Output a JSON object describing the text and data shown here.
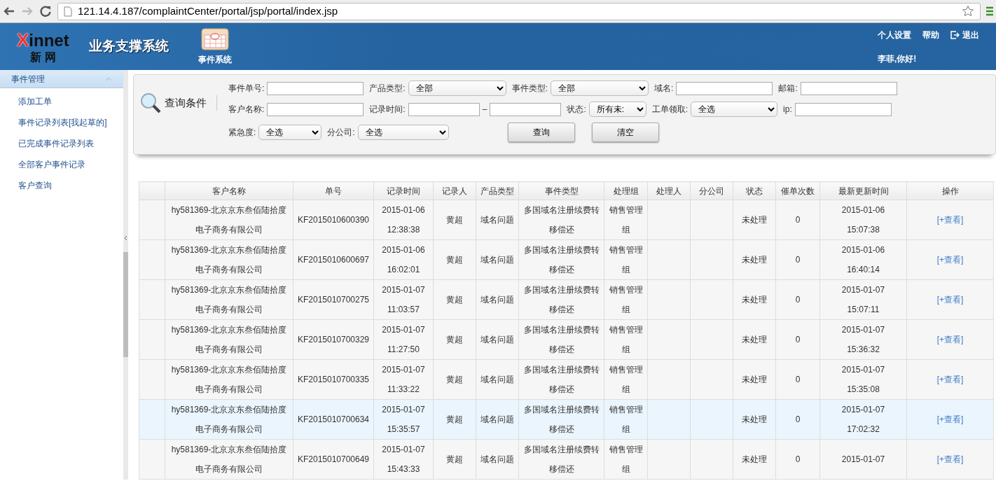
{
  "browser": {
    "url": "121.14.4.187/complaintCenter/portal/jsp/portal/index.jsp",
    "forward_disabled": true
  },
  "header": {
    "logo": {
      "mark": "X",
      "word": "innet",
      "cn": "新 网"
    },
    "title": "业务支撑系统",
    "app": "事件系统",
    "links": [
      {
        "label": "个人设置",
        "kind": "text"
      },
      {
        "label": "帮助",
        "kind": "text"
      },
      {
        "label": "退出",
        "kind": "exit"
      }
    ],
    "greeting": "李菲,你好!"
  },
  "sidebar": {
    "title": "事件管理",
    "expanded": true,
    "items": [
      "添加工单",
      "事件记录列表[我起草的]",
      "已完成事件记录列表",
      "全部客户事件记录",
      "客户查询"
    ]
  },
  "query": {
    "title": "查询条件",
    "rows": [
      [
        {
          "label": "事件单号:",
          "kind": "text"
        },
        {
          "label": "产品类型:",
          "kind": "select",
          "value": "全部"
        },
        {
          "label": "事件类型:",
          "kind": "select",
          "value": "全部"
        },
        {
          "label": "域名:",
          "kind": "text"
        },
        {
          "label": "邮箱:",
          "kind": "text"
        }
      ],
      [
        {
          "label": "客户名称:",
          "kind": "text"
        },
        {
          "label": "记录时间:",
          "kind": "range",
          "separator": "–"
        },
        {
          "label": "状态:",
          "kind": "select",
          "value": "所有未:"
        },
        {
          "label": "工单领取:",
          "kind": "select",
          "value": "全选"
        },
        {
          "label": "ip:",
          "kind": "text"
        }
      ],
      [
        {
          "label": "紧急度:",
          "kind": "select",
          "value": "全选"
        },
        {
          "label": "分公司:",
          "kind": "select",
          "value": "全选"
        }
      ]
    ],
    "buttons": [
      "查询",
      "清空"
    ]
  },
  "table": {
    "columns": [
      "",
      "客户名称",
      "单号",
      "记录时间",
      "记录人",
      "产品类型",
      "事件类型",
      "处理组",
      "处理人",
      "分公司",
      "状态",
      "催单次数",
      "最新更新时间",
      "操作"
    ],
    "rows": [
      {
        "highlighted": false,
        "cells": [
          "",
          "hy581369-北京京东叁佰陆拾度电子商务有限公司",
          "KF2015010600390",
          "2015-01-06 12:38:38",
          "黄超",
          "域名问题",
          "多国域名注册续费转移偿还",
          "销售管理组",
          "",
          "",
          "未处理",
          "0",
          "2015-01-06 15:07:38",
          "[+查看]"
        ]
      },
      {
        "highlighted": false,
        "cells": [
          "",
          "hy581369-北京京东叁佰陆拾度电子商务有限公司",
          "KF2015010600697",
          "2015-01-06 16:02:01",
          "黄超",
          "域名问题",
          "多国域名注册续费转移偿还",
          "销售管理组",
          "",
          "",
          "未处理",
          "0",
          "2015-01-06 16:40:14",
          "[+查看]"
        ]
      },
      {
        "highlighted": false,
        "cells": [
          "",
          "hy581369-北京京东叁佰陆拾度电子商务有限公司",
          "KF2015010700275",
          "2015-01-07 11:03:57",
          "黄超",
          "域名问题",
          "多国域名注册续费转移偿还",
          "销售管理组",
          "",
          "",
          "未处理",
          "0",
          "2015-01-07 15:07:11",
          "[+查看]"
        ]
      },
      {
        "highlighted": false,
        "cells": [
          "",
          "hy581369-北京京东叁佰陆拾度电子商务有限公司",
          "KF2015010700329",
          "2015-01-07 11:27:50",
          "黄超",
          "域名问题",
          "多国域名注册续费转移偿还",
          "销售管理组",
          "",
          "",
          "未处理",
          "0",
          "2015-01-07 15:36:32",
          "[+查看]"
        ]
      },
      {
        "highlighted": false,
        "cells": [
          "",
          "hy581369-北京京东叁佰陆拾度电子商务有限公司",
          "KF2015010700335",
          "2015-01-07 11:33:22",
          "黄超",
          "域名问题",
          "多国域名注册续费转移偿还",
          "销售管理组",
          "",
          "",
          "未处理",
          "0",
          "2015-01-07 15:35:08",
          "[+查看]"
        ]
      },
      {
        "highlighted": true,
        "cells": [
          "",
          "hy581369-北京京东叁佰陆拾度电子商务有限公司",
          "KF2015010700634",
          "2015-01-07 15:35:57",
          "黄超",
          "域名问题",
          "多国域名注册续费转移偿还",
          "销售管理组",
          "",
          "",
          "未处理",
          "0",
          "2015-01-07 17:02:32",
          "[+查看]"
        ]
      },
      {
        "highlighted": false,
        "cells": [
          "",
          "hy581369-北京京东叁佰陆拾度电子商务有限公司",
          "KF2015010700649",
          "2015-01-07 15:43:33",
          "黄超",
          "域名问题",
          "多国域名注册续费转移偿还",
          "销售管理组",
          "",
          "",
          "未处理",
          "0",
          "2015-01-07",
          "[+查看]"
        ]
      }
    ]
  }
}
